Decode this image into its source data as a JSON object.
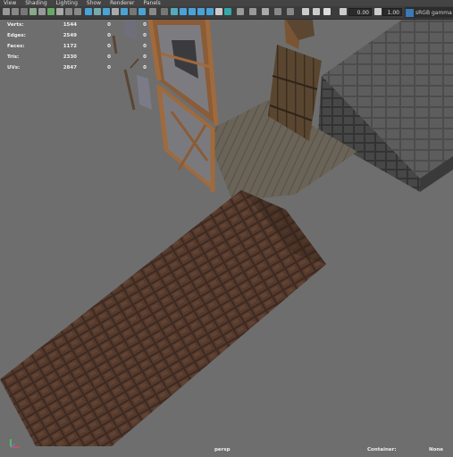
{
  "menu": [
    "View",
    "Shading",
    "Lighting",
    "Show",
    "Renderer",
    "Panels"
  ],
  "toolbar": {
    "field1": "0.00",
    "field2": "1.00",
    "colorspace": "sRGB gamma"
  },
  "hud": {
    "rows": [
      {
        "label": "Verts:",
        "value": "1544",
        "sel": "0",
        "comp": "0"
      },
      {
        "label": "Edges:",
        "value": "2549",
        "sel": "0",
        "comp": "0"
      },
      {
        "label": "Faces:",
        "value": "1172",
        "sel": "0",
        "comp": "0"
      },
      {
        "label": "Tris:",
        "value": "2330",
        "sel": "0",
        "comp": "0"
      },
      {
        "label": "UVs:",
        "value": "2847",
        "sel": "0",
        "comp": "0"
      }
    ]
  },
  "bottom": {
    "camera": "persp",
    "container_label": "Container:",
    "container_value": "None"
  },
  "colors": {
    "background": "#6e6e6e",
    "menubar": "#444444",
    "toolbar": "#3c3c3c",
    "roof": "#4a3328",
    "stone": "#565656",
    "wood": "#8a5a34",
    "plank": "#6b6458"
  }
}
